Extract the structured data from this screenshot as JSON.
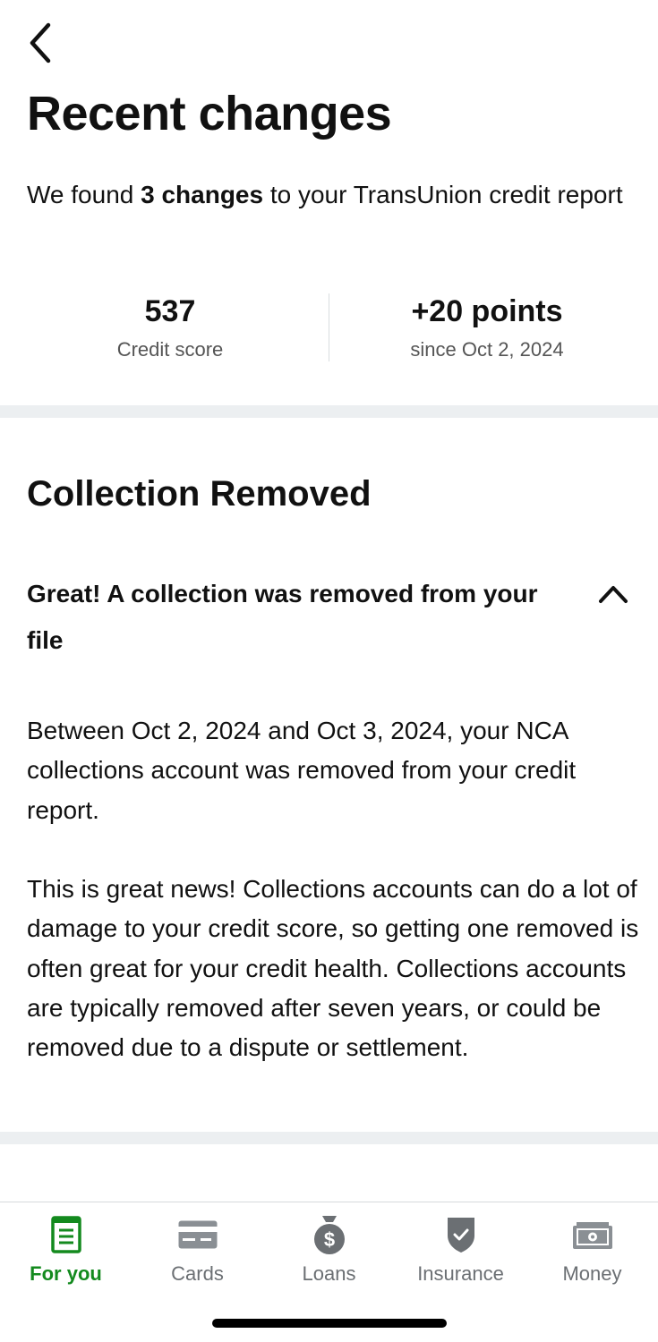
{
  "header": {
    "back_icon": "chevron-left-icon",
    "title": "Recent changes"
  },
  "intro": {
    "prefix": "We found ",
    "highlight": "3 changes",
    "suffix": " to your TransUnion credit report"
  },
  "stats": {
    "score_value": "537",
    "score_label": "Credit score",
    "change_value": "+20 points",
    "change_label": "since Oct 2, 2024"
  },
  "section": {
    "title": "Collection Removed",
    "accordion_title": "Great! A collection was removed from your file",
    "accordion_icon": "chevron-up-icon",
    "paragraph_1": "Between Oct 2, 2024 and Oct 3, 2024, your NCA collections account was removed from your credit report.",
    "paragraph_2": "This is great news! Collections accounts can do a lot of damage to your credit score, so getting one removed is often great for your credit health. Collections accounts are typically removed after seven years, or could be removed due to a dispute or settlement."
  },
  "tabbar": {
    "tabs": [
      {
        "label": "For you",
        "icon": "document-icon",
        "active": true
      },
      {
        "label": "Cards",
        "icon": "credit-card-icon",
        "active": false
      },
      {
        "label": "Loans",
        "icon": "money-bag-icon",
        "active": false
      },
      {
        "label": "Insurance",
        "icon": "shield-check-icon",
        "active": false
      },
      {
        "label": "Money",
        "icon": "banknote-icon",
        "active": false
      }
    ]
  },
  "colors": {
    "accent": "#138a1e",
    "muted_text": "#6b6f73",
    "divider_band": "#eceff1"
  }
}
